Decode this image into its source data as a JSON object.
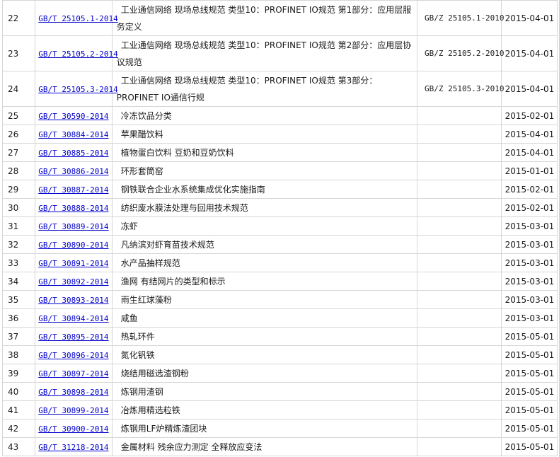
{
  "rows": [
    {
      "no": "22",
      "code": "GB/T 25105.1-2014",
      "name": "工业通信网络 现场总线规范 类型10：PROFINET IO规范 第1部分：应用层服务定义",
      "replaced": "GB/Z 25105.1-2010",
      "date": "2015-04-01"
    },
    {
      "no": "23",
      "code": "GB/T 25105.2-2014",
      "name": "工业通信网络 现场总线规范 类型10：PROFINET IO规范 第2部分：应用层协议规范",
      "replaced": "GB/Z 25105.2-2010",
      "date": "2015-04-01"
    },
    {
      "no": "24",
      "code": "GB/T 25105.3-2014",
      "name": "工业通信网络 现场总线规范 类型10：PROFINET IO规范 第3部分：PROFINET IO通信行规",
      "replaced": "GB/Z 25105.3-2010",
      "date": "2015-04-01"
    },
    {
      "no": "25",
      "code": "GB/T 30590-2014",
      "name": "冷冻饮品分类",
      "replaced": "",
      "date": "2015-02-01"
    },
    {
      "no": "26",
      "code": "GB/T 30884-2014",
      "name": "苹果醋饮料",
      "replaced": "",
      "date": "2015-04-01"
    },
    {
      "no": "27",
      "code": "GB/T 30885-2014",
      "name": "植物蛋白饮料 豆奶和豆奶饮料",
      "replaced": "",
      "date": "2015-04-01"
    },
    {
      "no": "28",
      "code": "GB/T 30886-2014",
      "name": "环形套筒窑",
      "replaced": "",
      "date": "2015-01-01"
    },
    {
      "no": "29",
      "code": "GB/T 30887-2014",
      "name": "钢铁联合企业水系统集成优化实施指南",
      "replaced": "",
      "date": "2015-02-01"
    },
    {
      "no": "30",
      "code": "GB/T 30888-2014",
      "name": "纺织废水膜法处理与回用技术规范",
      "replaced": "",
      "date": "2015-02-01"
    },
    {
      "no": "31",
      "code": "GB/T 30889-2014",
      "name": "冻虾",
      "replaced": "",
      "date": "2015-03-01"
    },
    {
      "no": "32",
      "code": "GB/T 30890-2014",
      "name": "凡纳滨对虾育苗技术规范",
      "replaced": "",
      "date": "2015-03-01"
    },
    {
      "no": "33",
      "code": "GB/T 30891-2014",
      "name": "水产品抽样规范",
      "replaced": "",
      "date": "2015-03-01"
    },
    {
      "no": "34",
      "code": "GB/T 30892-2014",
      "name": "渔网 有结网片的类型和标示",
      "replaced": "",
      "date": "2015-03-01"
    },
    {
      "no": "35",
      "code": "GB/T 30893-2014",
      "name": "雨生红球藻粉",
      "replaced": "",
      "date": "2015-03-01"
    },
    {
      "no": "36",
      "code": "GB/T 30894-2014",
      "name": "咸鱼",
      "replaced": "",
      "date": "2015-03-01"
    },
    {
      "no": "37",
      "code": "GB/T 30895-2014",
      "name": "热轧环件",
      "replaced": "",
      "date": "2015-05-01"
    },
    {
      "no": "38",
      "code": "GB/T 30896-2014",
      "name": "氮化钒铁",
      "replaced": "",
      "date": "2015-05-01"
    },
    {
      "no": "39",
      "code": "GB/T 30897-2014",
      "name": "烧结用磁选渣钢粉",
      "replaced": "",
      "date": "2015-05-01"
    },
    {
      "no": "40",
      "code": "GB/T 30898-2014",
      "name": "炼钢用渣钢",
      "replaced": "",
      "date": "2015-05-01"
    },
    {
      "no": "41",
      "code": "GB/T 30899-2014",
      "name": "冶炼用精选粒铁",
      "replaced": "",
      "date": "2015-05-01"
    },
    {
      "no": "42",
      "code": "GB/T 30900-2014",
      "name": "炼钢用LF炉精炼渣团块",
      "replaced": "",
      "date": "2015-05-01"
    },
    {
      "no": "43",
      "code": "GB/T 31218-2014",
      "name": "金属材料 残余应力测定 全释放应变法",
      "replaced": "",
      "date": "2015-05-01"
    }
  ]
}
